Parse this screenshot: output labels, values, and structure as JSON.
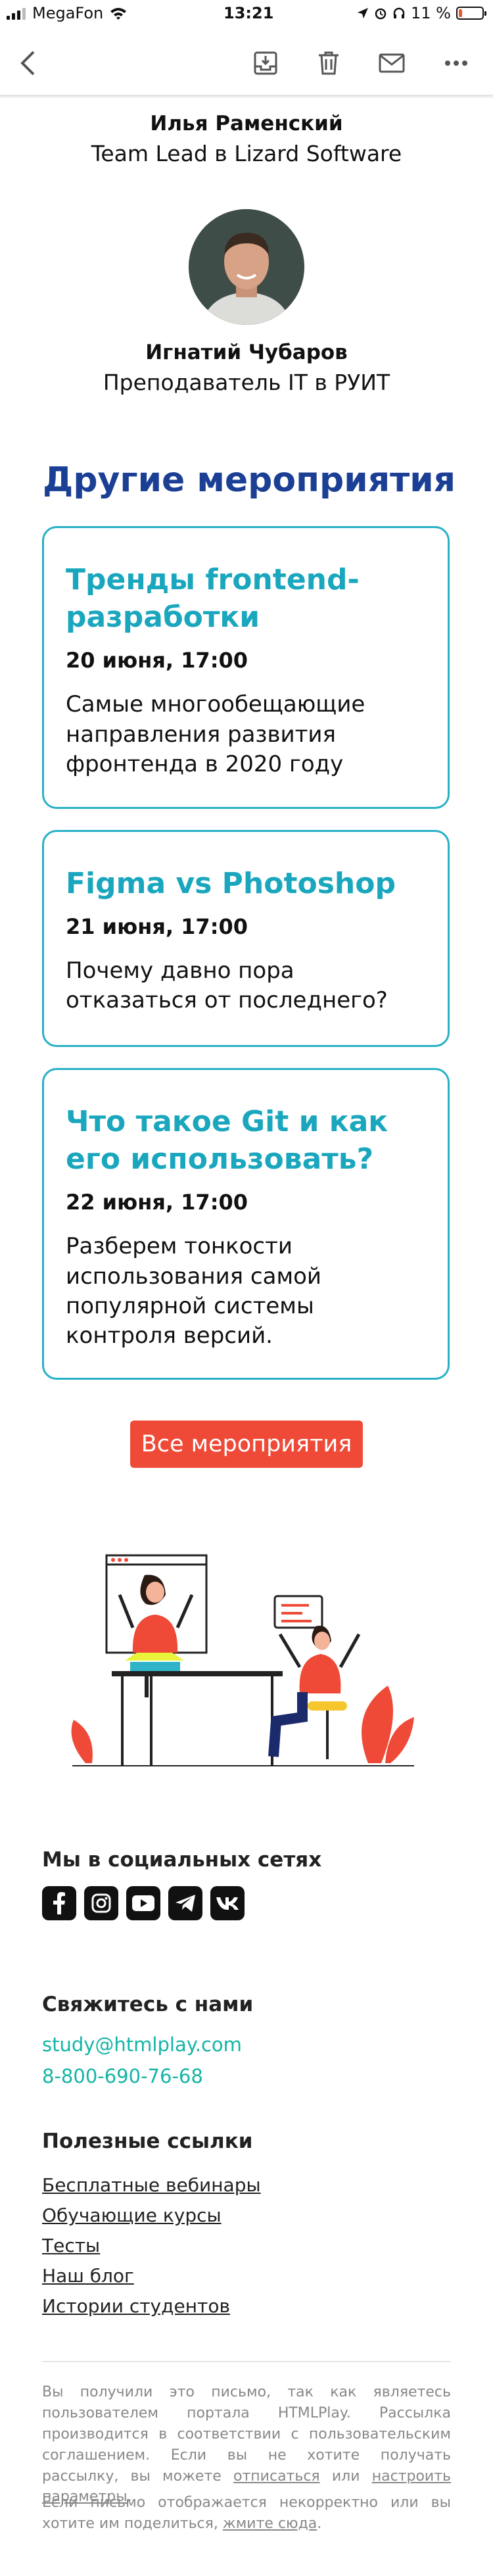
{
  "status_bar": {
    "carrier": "MegaFon",
    "time": "13:21",
    "battery": "11 %",
    "battery_level": 0.11
  },
  "nav": {
    "back_icon": "chevron-left-icon",
    "archive_icon": "archive-icon",
    "trash_icon": "trash-icon",
    "mail_icon": "mail-icon",
    "more_icon": "more-icon"
  },
  "speakers": [
    {
      "name": "Илья Раменский",
      "role": "Team Lead в Lizard Software"
    },
    {
      "name": "Игнатий Чубаров",
      "role": "Преподаватель IT в РУИТ"
    }
  ],
  "events_section": {
    "title": "Другие мероприятия",
    "items": [
      {
        "title": "Тренды frontend-разработки",
        "date": "20 июня, 17:00",
        "desc": "Самые многообещающие направления развития фронтенда в 2020 году"
      },
      {
        "title": "Figma vs Photoshop",
        "date": "21 июня, 17:00",
        "desc": "Почему давно пора отказаться от последнего?"
      },
      {
        "title": "Что такое Git и как его использовать?",
        "date": "22 июня, 17:00",
        "desc": "Разберем тонкости использования самой популярной системы контроля версий."
      }
    ],
    "cta": "Все мероприятия"
  },
  "footer": {
    "social_title": "Мы в социальных сетях",
    "social_icons": [
      "facebook-icon",
      "instagram-icon",
      "youtube-icon",
      "telegram-icon",
      "vk-icon"
    ],
    "contact_title": "Свяжитесь с нами",
    "email": "study@htmlplay.com",
    "phone": "8-800-690-76-68",
    "links_title": "Полезные ссылки",
    "links": [
      "Бесплатные вебинары",
      "Обучающие курсы",
      "Тесты",
      "Наш блог",
      "Истории студентов"
    ],
    "fine_print_1": "Вы получили это письмо, так как являетесь пользователем портала HTMLPlay. Рассылка производится в соответствии с пользовательским соглашением. Если вы не хотите получать рассылку, вы можете",
    "unsubscribe": "отписаться",
    "or": "или",
    "settings": "настроить параметры",
    "fine_print_2": "Если письмо отображается некорректно или вы хотите им поделиться,",
    "view_here": "жмите сюда"
  },
  "colors": {
    "heading": "#1b3f94",
    "accent": "#27b0c6",
    "cta": "#ee4a37",
    "contact": "#14b5a6"
  }
}
